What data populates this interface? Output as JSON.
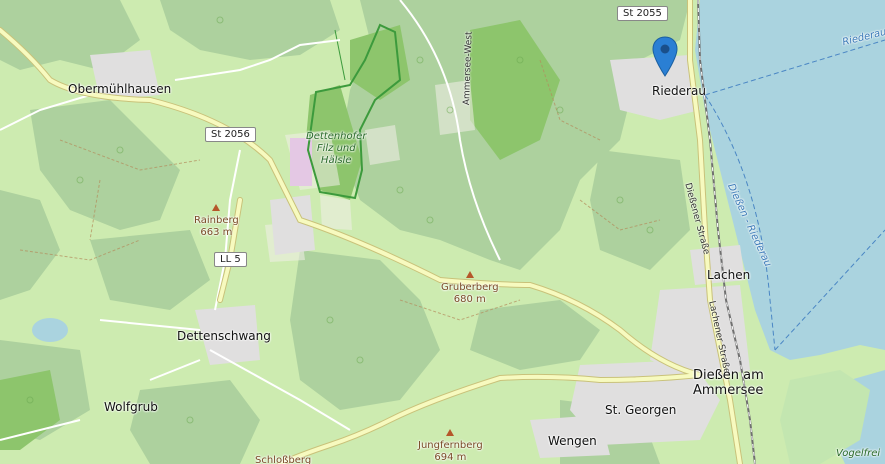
{
  "map": {
    "places": {
      "obermuehlhausen": "Obermühlhausen",
      "riederau": "Riederau",
      "lachen": "Lachen",
      "dettenschwang": "Dettenschwang",
      "wolfgrub": "Wolfgrub",
      "st_georgen": "St. Georgen",
      "wengen": "Wengen",
      "diessen_line1": "Dießen am",
      "diessen_line2": "Ammersee",
      "schlossberg_partial": "Schloßberg"
    },
    "nature": {
      "dettenhofer_line1": "Dettenhofer",
      "dettenhofer_line2": "Filz und",
      "dettenhofer_line3": "Hälsle",
      "vogelfrei_partial": "Vogelfrei"
    },
    "peaks": [
      {
        "name": "Rainberg",
        "elevation": "663 m"
      },
      {
        "name": "Gruberberg",
        "elevation": "680 m"
      },
      {
        "name": "Jungfernberg",
        "elevation": "694 m"
      }
    ],
    "roads": {
      "st2055": "St 2055",
      "st2056": "St 2056",
      "ll5": "LL 5",
      "ammersee_west": "Ammersee-West",
      "diessener_strasse": "Dießener Straße",
      "lachener_strasse": "Lachener Straße"
    },
    "water": {
      "riederau_line": "Riederau",
      "diessen_riederau_line": "Dießen - Riederau"
    },
    "colors": {
      "meadow": "#cdebb0",
      "forest": "#add19e",
      "dense_forest": "#8dc56c",
      "water": "#aad3df",
      "urban": "#e0dfdf",
      "primary_road": "#f7fabf",
      "road_casing": "#c9c27a",
      "marker": "#2a7fd4"
    },
    "marker_icon": "location-pin-icon"
  }
}
